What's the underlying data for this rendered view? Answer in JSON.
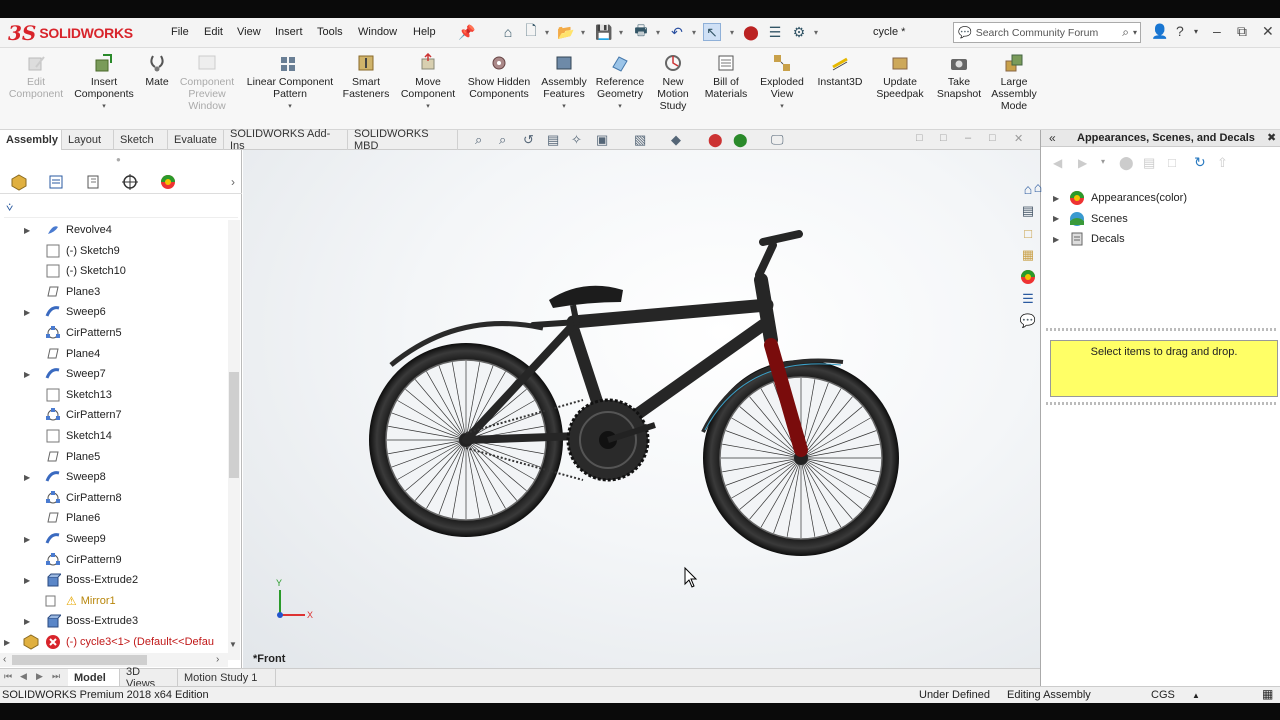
{
  "app": {
    "brand_ds": "3S",
    "brand_name": "SOLIDWORKS",
    "document_title": "cycle *"
  },
  "menu": [
    "File",
    "Edit",
    "View",
    "Insert",
    "Tools",
    "Window",
    "Help"
  ],
  "search": {
    "placeholder": "Search Community Forum"
  },
  "command_manager": [
    {
      "label": "Edit Component",
      "enabled": false,
      "icon": "edit-component-icon"
    },
    {
      "label": "Insert Components",
      "enabled": true,
      "icon": "insert-components-icon"
    },
    {
      "label": "Mate",
      "enabled": true,
      "icon": "mate-icon"
    },
    {
      "label": "Component Preview Window",
      "enabled": false,
      "icon": "preview-window-icon"
    },
    {
      "label": "Linear Component Pattern",
      "enabled": true,
      "icon": "linear-pattern-icon"
    },
    {
      "label": "Smart Fasteners",
      "enabled": true,
      "icon": "smart-fasteners-icon"
    },
    {
      "label": "Move Component",
      "enabled": true,
      "icon": "move-component-icon"
    },
    {
      "label": "Show Hidden Components",
      "enabled": true,
      "icon": "show-hidden-icon"
    },
    {
      "label": "Assembly Features",
      "enabled": true,
      "icon": "assembly-features-icon"
    },
    {
      "label": "Reference Geometry",
      "enabled": true,
      "icon": "reference-geometry-icon"
    },
    {
      "label": "New Motion Study",
      "enabled": true,
      "icon": "motion-study-icon"
    },
    {
      "label": "Bill of Materials",
      "enabled": true,
      "icon": "bom-icon"
    },
    {
      "label": "Exploded View",
      "enabled": true,
      "icon": "exploded-view-icon"
    },
    {
      "label": "Instant3D",
      "enabled": true,
      "icon": "instant3d-icon"
    },
    {
      "label": "Update Speedpak",
      "enabled": true,
      "icon": "speedpak-icon"
    },
    {
      "label": "Take Snapshot",
      "enabled": true,
      "icon": "snapshot-icon"
    },
    {
      "label": "Large Assembly Mode",
      "enabled": true,
      "icon": "large-assembly-icon"
    }
  ],
  "tabs": [
    "Assembly",
    "Layout",
    "Sketch",
    "Evaluate",
    "SOLIDWORKS Add-Ins",
    "SOLIDWORKS MBD"
  ],
  "active_tab": "Assembly",
  "feature_tree": [
    {
      "label": "Revolve4",
      "type": "feature",
      "expandable": true
    },
    {
      "label": "(-) Sketch9",
      "type": "sketch",
      "expandable": false
    },
    {
      "label": "(-) Sketch10",
      "type": "sketch",
      "expandable": false
    },
    {
      "label": "Plane3",
      "type": "plane",
      "expandable": false
    },
    {
      "label": "Sweep6",
      "type": "sweep",
      "expandable": true
    },
    {
      "label": "CirPattern5",
      "type": "pattern",
      "expandable": false
    },
    {
      "label": "Plane4",
      "type": "plane",
      "expandable": false
    },
    {
      "label": "Sweep7",
      "type": "sweep",
      "expandable": true
    },
    {
      "label": "Sketch13",
      "type": "sketch",
      "expandable": false
    },
    {
      "label": "CirPattern7",
      "type": "pattern",
      "expandable": false
    },
    {
      "label": "Sketch14",
      "type": "sketch",
      "expandable": false
    },
    {
      "label": "Plane5",
      "type": "plane",
      "expandable": false
    },
    {
      "label": "Sweep8",
      "type": "sweep",
      "expandable": true
    },
    {
      "label": "CirPattern8",
      "type": "pattern",
      "expandable": false
    },
    {
      "label": "Plane6",
      "type": "plane",
      "expandable": false
    },
    {
      "label": "Sweep9",
      "type": "sweep",
      "expandable": true
    },
    {
      "label": "CirPattern9",
      "type": "pattern",
      "expandable": false
    },
    {
      "label": "Boss-Extrude2",
      "type": "extrude",
      "expandable": true
    },
    {
      "label": "Mirror1",
      "type": "warning",
      "expandable": false
    },
    {
      "label": "Boss-Extrude3",
      "type": "extrude",
      "expandable": true
    },
    {
      "label": "(-) cycle3<1> (Default<<Defau",
      "type": "error",
      "expandable": true
    }
  ],
  "viewport": {
    "view_label": "*Front",
    "axis_y": "Y",
    "axis_x": "X"
  },
  "bottom_tabs": [
    "Model",
    "3D Views",
    "Motion Study 1"
  ],
  "active_bottom_tab": "Model",
  "status": {
    "edition": "SOLIDWORKS Premium 2018 x64 Edition",
    "definition": "Under Defined",
    "mode": "Editing Assembly",
    "units": "CGS"
  },
  "task_pane": {
    "title": "Appearances, Scenes, and Decals",
    "items": [
      {
        "label": "Appearances(color)",
        "icon": "appearance-ball-icon"
      },
      {
        "label": "Scenes",
        "icon": "scenes-icon"
      },
      {
        "label": "Decals",
        "icon": "decals-icon"
      }
    ],
    "drag_hint": "Select items to drag and drop."
  },
  "colors": {
    "brand_red": "#d8242b",
    "fork_red": "#8b0a0a",
    "hint_yellow": "#ffff66",
    "accent_blue": "#1e62b8"
  }
}
